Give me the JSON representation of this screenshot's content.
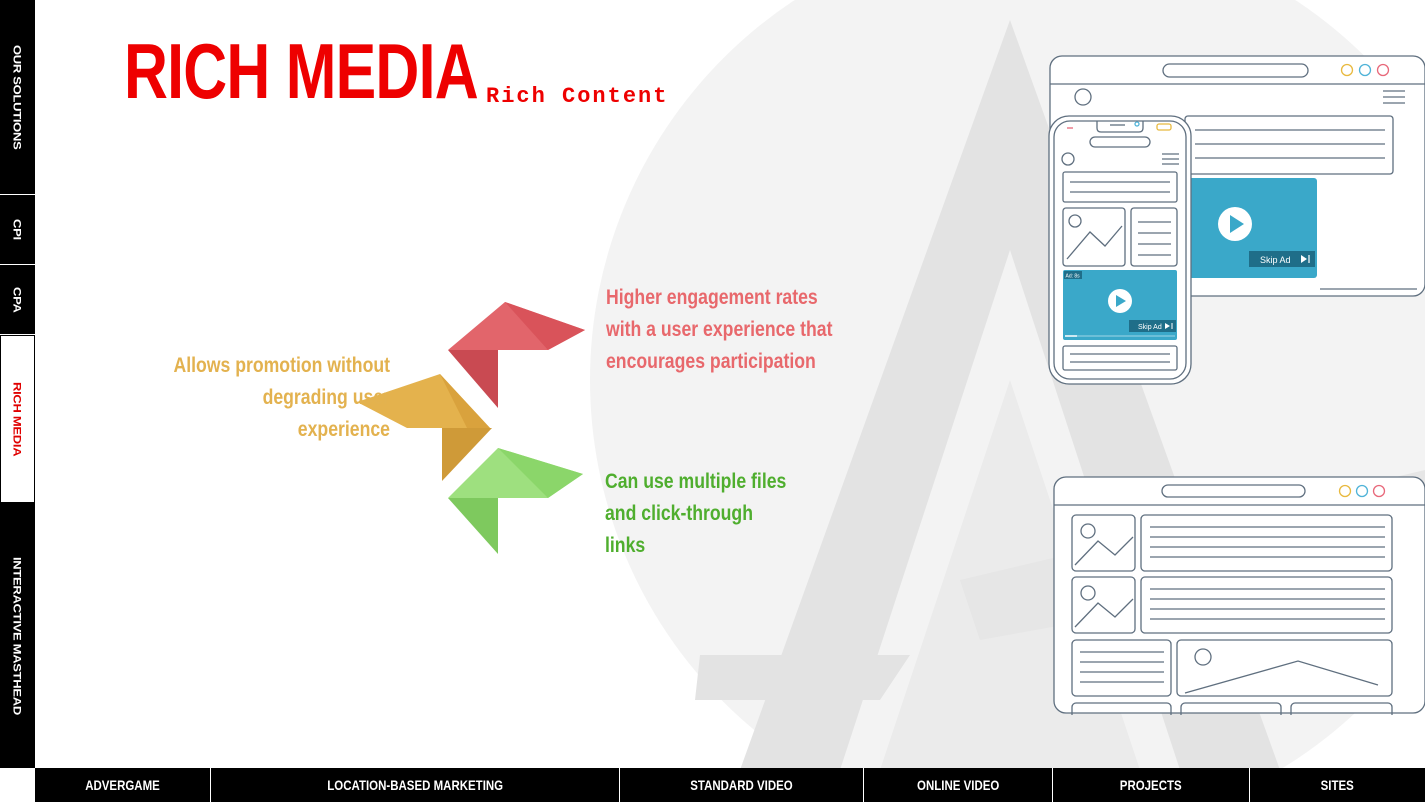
{
  "page": {
    "title": "RICH MEDIA",
    "subtitle": "Rich Content"
  },
  "side_nav": {
    "items": [
      {
        "label": "OUR SOLUTIONS"
      },
      {
        "label": "CPI"
      },
      {
        "label": "CPA"
      },
      {
        "label": "RICH MEDIA",
        "active": true
      },
      {
        "label": "INTERACTIVE MASTHEAD"
      }
    ]
  },
  "bottom_nav": {
    "items": [
      {
        "label": "ADVERGAME"
      },
      {
        "label": "LOCATION-BASED MARKETING"
      },
      {
        "label": "STANDARD VIDEO"
      },
      {
        "label": "ONLINE VIDEO"
      },
      {
        "label": "PROJECTS"
      },
      {
        "label": "SITES"
      }
    ]
  },
  "points": {
    "left": {
      "lines": [
        "Allows promotion without",
        "degrading user",
        "experience"
      ],
      "color": "#e3b24f"
    },
    "top": {
      "lines": [
        "Higher engagement rates",
        "with a user experience that",
        "encourages participation"
      ],
      "color": "#e8686c"
    },
    "bottom": {
      "lines": [
        "Can use multiple files",
        "and click-through",
        "links"
      ],
      "color": "#4fae2e"
    }
  },
  "mockups": {
    "desktop_skip_label": "Skip Ad",
    "phone_skip_label": "Skip Ad",
    "phone_ad_badge": "Ad: 8s"
  },
  "colors": {
    "accent": "#ee0000",
    "nav_bg": "#000000",
    "video_blue": "#3aa8c9",
    "arrow_red": "#e2656b",
    "arrow_yellow": "#e4b24d",
    "arrow_green": "#9ee07f"
  }
}
